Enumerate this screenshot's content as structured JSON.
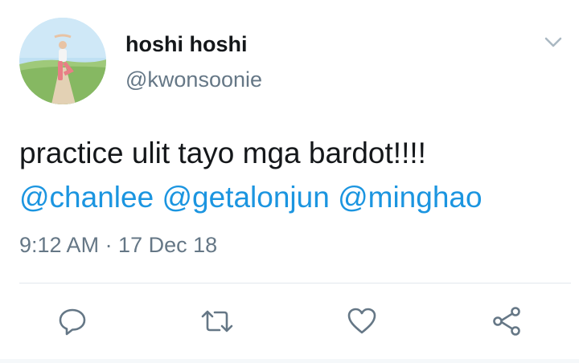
{
  "user": {
    "display_name": "hoshi hoshi",
    "handle": "@kwonsoonie"
  },
  "tweet": {
    "text_line1": "practice ulit tayo mga bardot!!!!",
    "mentions": [
      "@chanlee",
      "@getalonjun",
      "@minghao"
    ],
    "timestamp": "9:12 AM · 17 Dec 18"
  },
  "icons": {
    "menu": "chevron-down-icon",
    "reply": "reply-icon",
    "retweet": "retweet-icon",
    "like": "heart-icon",
    "share": "share-icon"
  },
  "colors": {
    "text": "#14171a",
    "secondary": "#657786",
    "link": "#1b95e0",
    "icon": "#657786",
    "divider": "#e1e8ed"
  }
}
